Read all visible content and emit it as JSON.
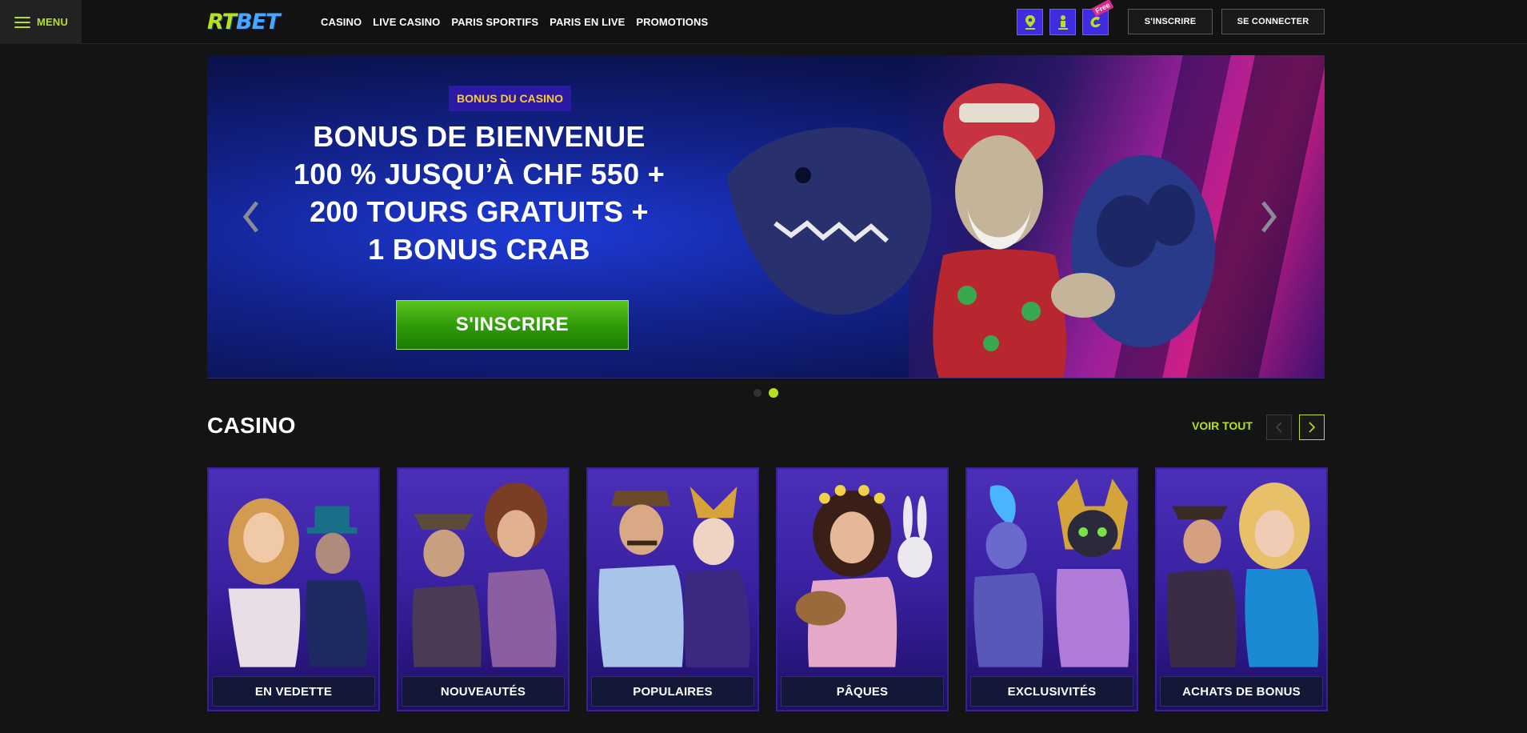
{
  "header": {
    "menu_label": "MENU",
    "logo_rt": "RT",
    "logo_bet": "BET",
    "nav": [
      "CASINO",
      "LIVE CASINO",
      "PARIS SPORTIFS",
      "PARIS EN LIVE",
      "PROMOTIONS"
    ],
    "icon_buttons": [
      "location-icon",
      "person-info-icon",
      "free-bonus-icon"
    ],
    "free_tag": "Free",
    "signup_label": "S'INSCRIRE",
    "login_label": "SE CONNECTER",
    "accent": "#b6e11b"
  },
  "hero": {
    "badge": "BONUS DU CASINO",
    "title_lines": [
      "BONUS DE BIENVENUE",
      "100 % JUSQU’À CHF 550 +",
      "200 TOURS GRATUITS +",
      "1 BONUS CRAB"
    ],
    "cta": "S'INSCRIRE",
    "slide_count": 2,
    "active_slide": 2
  },
  "casino": {
    "title": "CASINO",
    "view_all": "VOIR TOUT",
    "cards": [
      {
        "label": "EN VEDETTE"
      },
      {
        "label": "NOUVEAUTÉS"
      },
      {
        "label": "POPULAIRES"
      },
      {
        "label": "PÂQUES"
      },
      {
        "label": "EXCLUSIVITÉS"
      },
      {
        "label": "ACHATS DE BONUS"
      }
    ]
  }
}
